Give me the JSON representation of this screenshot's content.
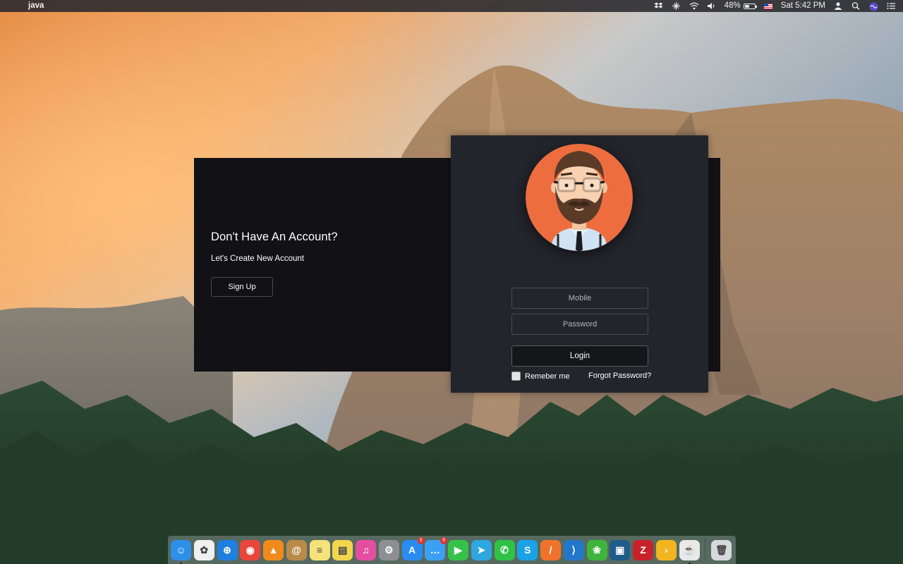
{
  "menubar": {
    "apple_glyph": "",
    "app_name": "java",
    "battery": "48%",
    "battery_fraction": 0.48,
    "clock": "Sat 5:42 PM",
    "icons": [
      "dropbox-icon",
      "network-icon",
      "wifi-icon",
      "volume-icon",
      "battery-icon",
      "input-source-flag-icon",
      "user-icon",
      "spotlight-search-icon",
      "siri-icon",
      "notification-center-icon"
    ]
  },
  "signup": {
    "title": "Don't Have An Account?",
    "subtitle": "Let's Create New Account",
    "button_label": "Sign Up"
  },
  "login": {
    "mobile_placeholder": "Mobile",
    "password_placeholder": "Password",
    "login_label": "Login",
    "remember_label": "Remeber me",
    "forgot_label": "Forgot Password?",
    "avatar_icon": "bearded-man-avatar-icon"
  },
  "dock": {
    "items": [
      {
        "name": "finder-icon",
        "glyph": "☺",
        "color": "#2d8fe8",
        "running": true
      },
      {
        "name": "photos-icon",
        "glyph": "✿",
        "color": "#f0f0f0"
      },
      {
        "name": "safari-icon",
        "glyph": "⊕",
        "color": "#1f7fe0"
      },
      {
        "name": "chrome-icon",
        "glyph": "◉",
        "color": "#e8453c"
      },
      {
        "name": "vlc-icon",
        "glyph": "▲",
        "color": "#f08a1c"
      },
      {
        "name": "contacts-icon",
        "glyph": "@",
        "color": "#b98a4a"
      },
      {
        "name": "notes-icon",
        "glyph": "≡",
        "color": "#f6e27a"
      },
      {
        "name": "stickies-icon",
        "glyph": "▤",
        "color": "#f3d54e"
      },
      {
        "name": "itunes-icon",
        "glyph": "♫",
        "color": "#e44ea0"
      },
      {
        "name": "system-preferences-icon",
        "glyph": "⚙",
        "color": "#8d8f94"
      },
      {
        "name": "app-store-icon",
        "glyph": "A",
        "color": "#2a8cf0",
        "badge": "3"
      },
      {
        "name": "messages-icon",
        "glyph": "…",
        "color": "#3aa0f3",
        "badge": "6"
      },
      {
        "name": "facetime-icon",
        "glyph": "▶",
        "color": "#36c24a"
      },
      {
        "name": "telegram-icon",
        "glyph": "➤",
        "color": "#2ea6de"
      },
      {
        "name": "whatsapp-icon",
        "glyph": "✆",
        "color": "#2fc247"
      },
      {
        "name": "skype-icon",
        "glyph": "S",
        "color": "#1aa2e6"
      },
      {
        "name": "swift-playgrounds-icon",
        "glyph": "/",
        "color": "#f0732c"
      },
      {
        "name": "vscode-icon",
        "glyph": "⟩",
        "color": "#2377c9"
      },
      {
        "name": "paw-icon",
        "glyph": "❀",
        "color": "#3db53d"
      },
      {
        "name": "intellij-icon",
        "glyph": "▣",
        "color": "#1e5d8a"
      },
      {
        "name": "filezilla-icon",
        "glyph": "Z",
        "color": "#c7222a"
      },
      {
        "name": "terminal-icon",
        "glyph": "›",
        "color": "#f2b520"
      },
      {
        "name": "preview-icon",
        "glyph": "☕",
        "color": "#e9e9e9",
        "running": true
      },
      {
        "name": "trash-icon",
        "glyph": "🗑",
        "color": "#d6d9dd"
      }
    ]
  }
}
